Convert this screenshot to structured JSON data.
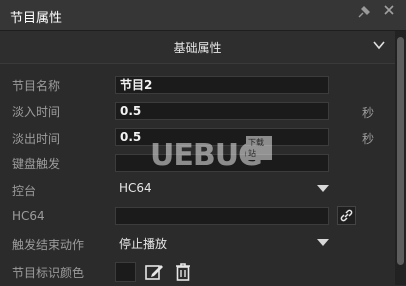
{
  "window": {
    "title": "节目属性"
  },
  "section": {
    "title": "基础属性"
  },
  "fields": {
    "name_label": "节目名称",
    "name_value": "节目2",
    "fadein_label": "淡入时间",
    "fadein_value": "0.5",
    "fadein_unit": "秒",
    "fadeout_label": "淡出时间",
    "fadeout_value": "0.5",
    "fadeout_unit": "秒",
    "hotkey_label": "键盘触发",
    "hotkey_value": "",
    "console_label": "控台",
    "console_value": "HC64",
    "hc64_label": "HC64",
    "hc64_value": "",
    "end_action_label": "触发结束动作",
    "end_action_value": "停止播放",
    "color_label": "节目标识颜色"
  },
  "watermark": {
    "text": "UEBUG",
    "badge": "下载站"
  },
  "icons": {
    "pin": "pin-icon",
    "close": "close-icon",
    "chevron": "chevron-down-icon",
    "link": "link-icon",
    "edit": "edit-icon",
    "trash": "trash-icon"
  }
}
